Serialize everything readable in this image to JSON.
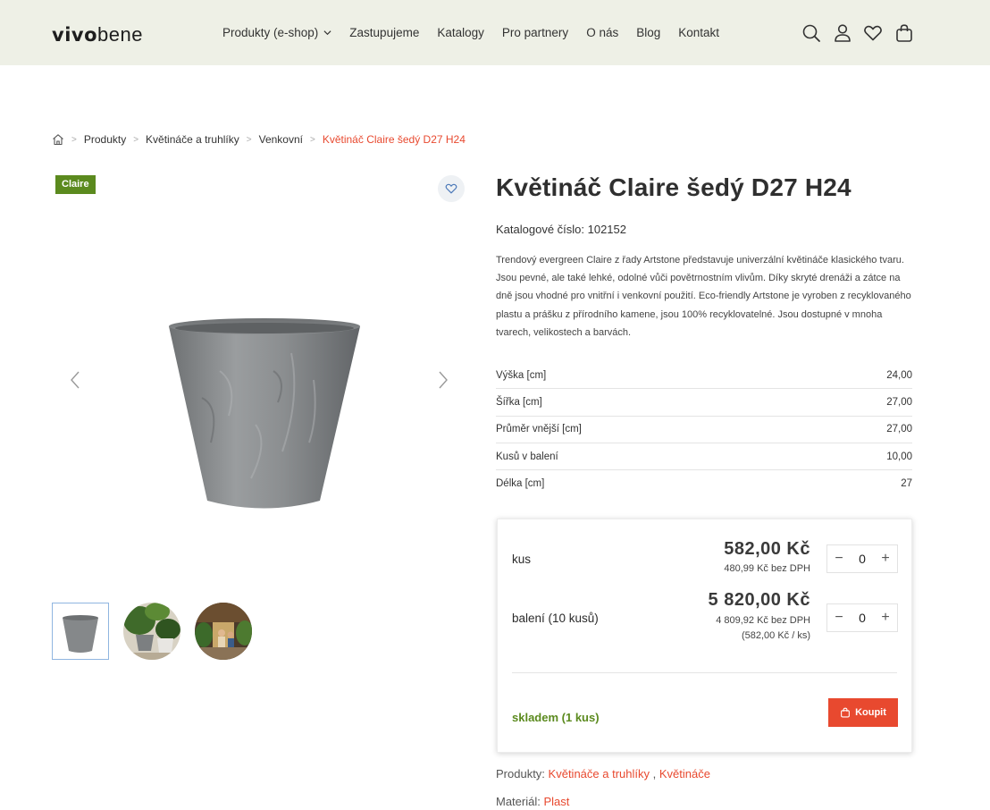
{
  "header": {
    "logo_bold": "vivo",
    "logo_light": "bene",
    "nav": [
      "Produkty (e-shop)",
      "Zastupujeme",
      "Katalogy",
      "Pro partnery",
      "O nás",
      "Blog",
      "Kontakt"
    ],
    "icons": [
      "search-icon",
      "user-icon",
      "heart-icon",
      "bag-icon"
    ]
  },
  "breadcrumb": {
    "items": [
      "Produkty",
      "Květináče a truhlíky",
      "Venkovní"
    ],
    "current": "Květináč Claire šedý D27 H24"
  },
  "gallery": {
    "badge": "Claire"
  },
  "product": {
    "title": "Květináč Claire šedý D27 H24",
    "catalog": "Katalogové číslo: 102152",
    "description": "Trendový evergreen Claire z řady Artstone představuje univerzální květináče klasického tvaru. Jsou pevné, ale také lehké, odolné vůči povětrnostním vlivům. Díky skryté drenáži a zátce na dně jsou vhodné pro vnitřní i venkovní použití. Eco-friendly Artstone je vyroben z recyklovaného plastu a prášku z přírodního kamene, jsou 100% recyklovatelné. Jsou dostupné v mnoha tvarech, velikostech a barvách.",
    "specs": [
      {
        "label": "Výška [cm]",
        "value": "24,00"
      },
      {
        "label": "Šířka [cm]",
        "value": "27,00"
      },
      {
        "label": "Průměr vnější [cm]",
        "value": "27,00"
      },
      {
        "label": "Kusů v balení",
        "value": "10,00"
      },
      {
        "label": "Délka [cm]",
        "value": "27"
      }
    ]
  },
  "pricing": {
    "unit": {
      "label": "kus",
      "price": "582,00 Kč",
      "net": "480,99 Kč bez DPH",
      "qty": "0"
    },
    "pack": {
      "label": "balení (10 kusů)",
      "price": "5 820,00 Kč",
      "net": "4 809,92 Kč bez DPH",
      "per": "(582,00 Kč / ks)",
      "qty": "0"
    },
    "stock": "skladem (1 kus)",
    "buy": "Koupit"
  },
  "meta": {
    "categories_label": "Produkty:",
    "categories": [
      "Květináče a truhlíky",
      "Květináče"
    ],
    "material_label": "Materiál:",
    "material": "Plast"
  },
  "colors": {
    "accent": "#e8492f",
    "green": "#5b8a1e",
    "header_bg": "#eef0e6"
  }
}
